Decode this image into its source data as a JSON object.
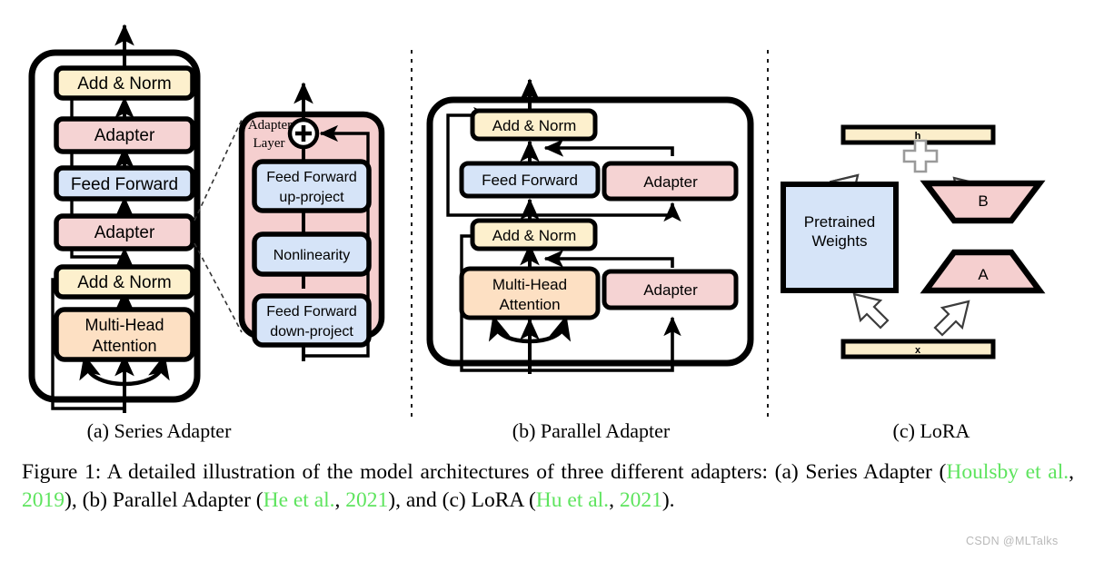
{
  "figure": {
    "panels": [
      {
        "id": "series-adapter",
        "caption": "(a) Series Adapter",
        "blocks": [
          {
            "name": "add-norm-top",
            "label": "Add & Norm",
            "color": "#fdf0cd"
          },
          {
            "name": "adapter-upper",
            "label": "Adapter",
            "color": "#f5d3d3"
          },
          {
            "name": "feed-forward",
            "label": "Feed Forward",
            "color": "#d6e4f8"
          },
          {
            "name": "adapter-lower",
            "label": "Adapter",
            "color": "#f5d3d3"
          },
          {
            "name": "add-norm-bottom",
            "label": "Add & Norm",
            "color": "#fdf0cd"
          },
          {
            "name": "multi-head-attention",
            "label": "Multi-Head\nAttention",
            "label_line1": "Multi-Head",
            "label_line2": "Attention",
            "color": "#fde0c3"
          }
        ]
      },
      {
        "id": "adapter-layer-detail",
        "title_line1": "Adapter",
        "title_line2": "Layer",
        "panel_color": "#f5cfcf",
        "plus_symbol": "+",
        "blocks": [
          {
            "name": "feed-forward-up-project",
            "label_line1": "Feed Forward",
            "label_line2": "up-project",
            "color": "#d6e4f8"
          },
          {
            "name": "nonlinearity",
            "label_line1": "Nonlinearity",
            "label_line2": "",
            "color": "#d6e4f8"
          },
          {
            "name": "feed-forward-down-project",
            "label_line1": "Feed Forward",
            "label_line2": "down-project",
            "color": "#d6e4f8"
          }
        ]
      },
      {
        "id": "parallel-adapter",
        "caption": "(b) Parallel Adapter",
        "blocks": [
          {
            "name": "add-norm-top",
            "label": "Add & Norm",
            "color": "#fdf0cd"
          },
          {
            "name": "feed-forward",
            "label": "Feed Forward",
            "color": "#d6e4f8"
          },
          {
            "name": "adapter-upper",
            "label": "Adapter",
            "color": "#f5d3d3"
          },
          {
            "name": "add-norm-bottom",
            "label": "Add & Norm",
            "color": "#fdf0cd"
          },
          {
            "name": "multi-head-attention",
            "label_line1": "Multi-Head",
            "label_line2": "Attention",
            "color": "#fde0c3"
          },
          {
            "name": "adapter-lower",
            "label": "Adapter",
            "color": "#f5d3d3"
          }
        ]
      },
      {
        "id": "lora",
        "caption": "(c) LoRA",
        "output_bar_label": "h",
        "input_bar_label": "x",
        "plus_symbol": "+",
        "pretrained_line1": "Pretrained",
        "pretrained_line2": "Weights",
        "matrix_b_label": "B",
        "matrix_a_label": "A",
        "bar_color": "#fbeecb",
        "weights_color": "#d6e4f8",
        "matrix_color": "#f5cfcf"
      }
    ],
    "caption": {
      "prefix": "Figure 1:  A detailed illustration of the model architectures of three different adapters:  (a) Series Adapter (",
      "cite1": "Houlsby et al.",
      "sep1": ", ",
      "cite1_year": "2019",
      "mid1": "), (b) Parallel Adapter (",
      "cite2": "He et al.",
      "sep2": ", ",
      "cite2_year": "2021",
      "mid2": "), and (c) LoRA (",
      "cite3": "Hu et al.",
      "sep3": ", ",
      "cite3_year": "2021",
      "suffix": ")."
    },
    "watermark": "CSDN @MLTalks",
    "colors": {
      "citation_green": "#5ee45e",
      "stroke": "#000000",
      "background": "#ffffff"
    }
  }
}
